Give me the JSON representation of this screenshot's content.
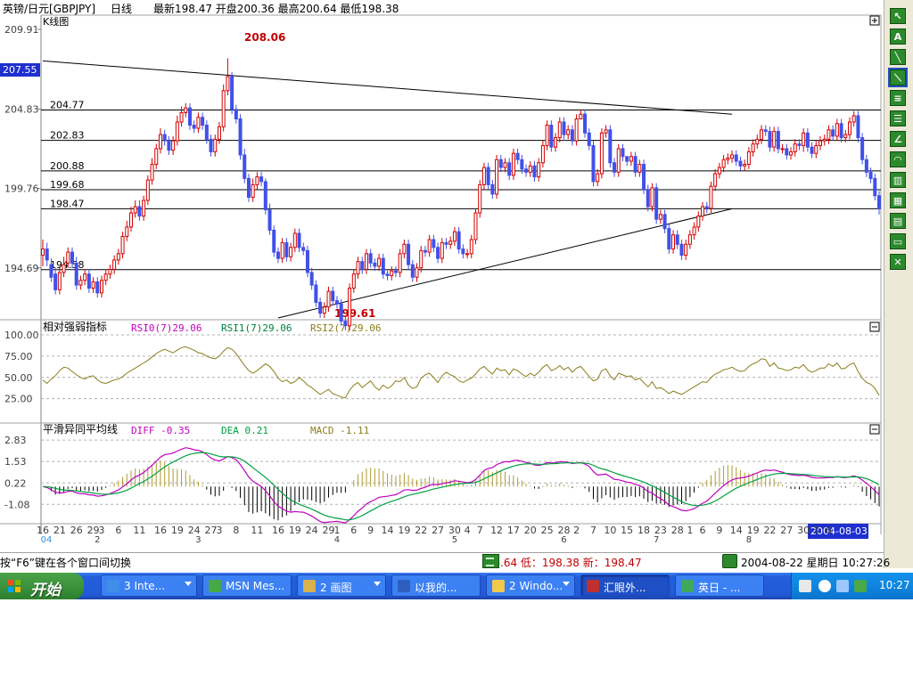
{
  "header": {
    "instrument": "英镑/日元[GBPJPY]",
    "period": "日线",
    "quote_line": "最新198.47 开盘200.36 最高200.64 最低198.38"
  },
  "chart_data": [
    {
      "type": "candlestick",
      "title": "K线图",
      "y_ticks": [
        209.91,
        204.83,
        199.76,
        194.69
      ],
      "ylim": [
        191.5,
        209.91
      ],
      "y_cursor": "207.55",
      "annotations": {
        "high": "208.06",
        "low": "199.61"
      },
      "price_levels": [
        "204.77",
        "202.83",
        "200.88",
        "199.68",
        "198.47",
        "194.58"
      ],
      "price_level_values": [
        204.77,
        202.83,
        200.88,
        199.68,
        198.47,
        194.58
      ],
      "trendline_upper": [
        {
          "i": 0,
          "v": 207.9
        },
        {
          "i": 164,
          "v": 204.5
        }
      ],
      "trendline_lower": [
        {
          "i": 56,
          "v": 191.5
        },
        {
          "i": 164,
          "v": 198.47
        }
      ],
      "x_day_labels": [
        "16",
        "21",
        "26",
        "29",
        "3",
        "6",
        "11",
        "16",
        "19",
        "24",
        "27",
        "3",
        "8",
        "11",
        "16",
        "19",
        "24",
        "29",
        "1",
        "6",
        "9",
        "14",
        "19",
        "22",
        "27",
        "30",
        "4",
        "7",
        "12",
        "17",
        "20",
        "25",
        "28",
        "2",
        "7",
        "10",
        "15",
        "18",
        "23",
        "28",
        "1",
        "6",
        "9",
        "14",
        "19",
        "22",
        "27",
        "30",
        "3",
        "6"
      ],
      "x_day_index": [
        0,
        4,
        8,
        12,
        14,
        18,
        23,
        28,
        32,
        36,
        40,
        42,
        46,
        51,
        56,
        60,
        64,
        68,
        70,
        74,
        78,
        82,
        86,
        90,
        94,
        98,
        101,
        104,
        108,
        112,
        116,
        120,
        124,
        127,
        131,
        135,
        139,
        143,
        147,
        151,
        154,
        157,
        161,
        165,
        169,
        173,
        177,
        181,
        184,
        187
      ],
      "x_month_labels": [
        "04",
        "2",
        "3",
        "4",
        "5",
        "6",
        "7",
        "8"
      ],
      "x_month_index": [
        0,
        13,
        37,
        70,
        98,
        124,
        146,
        168
      ],
      "cursor_date": "2004-08-03",
      "close": [
        195.9,
        195.2,
        194.1,
        193.3,
        194.4,
        194.9,
        195.7,
        195.0,
        193.6,
        193.9,
        194.3,
        193.4,
        193.8,
        193.1,
        193.9,
        194.3,
        194.6,
        195.2,
        195.6,
        196.7,
        197.3,
        198.2,
        198.6,
        198.0,
        199.0,
        200.3,
        201.3,
        202.3,
        203.2,
        202.8,
        202.2,
        202.8,
        204.0,
        204.6,
        204.9,
        203.8,
        203.6,
        204.3,
        203.8,
        202.9,
        202.1,
        202.9,
        203.7,
        206.0,
        206.9,
        204.8,
        204.2,
        201.9,
        200.4,
        199.2,
        200.0,
        200.5,
        200.2,
        198.4,
        197.1,
        195.7,
        195.3,
        196.3,
        195.4,
        196.0,
        196.9,
        196.0,
        195.8,
        194.4,
        193.6,
        192.5,
        191.8,
        192.2,
        193.2,
        192.6,
        192.4,
        191.3,
        191.0,
        193.4,
        194.3,
        195.1,
        194.6,
        195.6,
        195.0,
        194.8,
        195.3,
        194.3,
        194.2,
        194.5,
        194.4,
        195.6,
        196.2,
        194.9,
        194.1,
        194.7,
        195.8,
        195.7,
        196.5,
        196.0,
        195.3,
        196.3,
        196.2,
        196.4,
        197.0,
        195.9,
        195.6,
        195.6,
        196.5,
        198.2,
        200.0,
        201.1,
        200.0,
        199.4,
        201.6,
        201.1,
        201.4,
        200.6,
        202.0,
        201.6,
        201.0,
        200.8,
        201.2,
        200.5,
        201.4,
        202.5,
        203.8,
        202.4,
        203.0,
        204.0,
        203.2,
        203.5,
        202.8,
        204.2,
        204.5,
        203.3,
        202.5,
        200.2,
        200.7,
        203.3,
        203.5,
        201.4,
        200.8,
        202.3,
        201.8,
        201.5,
        201.8,
        200.8,
        201.3,
        199.7,
        198.6,
        199.8,
        197.8,
        198.1,
        197.2,
        195.9,
        196.8,
        196.2,
        195.5,
        196.2,
        196.8,
        197.3,
        198.0,
        198.6,
        198.5,
        199.9,
        200.7,
        201.1,
        201.6,
        201.7,
        201.9,
        201.5,
        201.2,
        201.3,
        202.1,
        202.6,
        202.9,
        203.5,
        203.4,
        202.4,
        203.4,
        202.3,
        202.3,
        201.9,
        202.1,
        202.6,
        202.5,
        203.3,
        202.4,
        202.0,
        202.5,
        202.8,
        202.9,
        203.5,
        203.1,
        203.9,
        203.0,
        203.2,
        204.0,
        204.4,
        203.0,
        201.6,
        200.8,
        200.4,
        199.3,
        198.47
      ],
      "open": [
        195.5,
        195.9,
        194.9,
        194.3,
        193.3,
        194.4,
        195.0,
        195.7,
        195.0,
        193.6,
        193.9,
        194.3,
        193.4,
        193.8,
        193.1,
        193.9,
        194.3,
        194.6,
        195.2,
        195.6,
        196.7,
        197.3,
        198.2,
        198.6,
        198.0,
        199.0,
        200.3,
        201.3,
        202.3,
        203.2,
        202.8,
        202.2,
        202.8,
        204.0,
        204.6,
        204.9,
        203.8,
        203.6,
        204.3,
        203.8,
        202.9,
        202.1,
        202.9,
        203.7,
        206.0,
        206.9,
        204.8,
        204.2,
        201.9,
        200.4,
        199.2,
        200.0,
        200.5,
        200.2,
        198.4,
        197.1,
        195.7,
        195.3,
        196.3,
        195.4,
        196.0,
        196.9,
        196.0,
        195.8,
        194.4,
        193.6,
        192.5,
        191.8,
        192.2,
        193.2,
        192.6,
        192.4,
        191.3,
        191.0,
        193.4,
        194.3,
        195.1,
        194.6,
        195.6,
        195.0,
        194.8,
        195.3,
        194.3,
        194.2,
        194.5,
        194.4,
        195.6,
        196.2,
        194.9,
        194.1,
        194.7,
        195.8,
        195.7,
        196.5,
        196.0,
        195.3,
        196.3,
        196.2,
        196.4,
        197.0,
        195.9,
        195.6,
        195.6,
        196.5,
        198.2,
        200.0,
        201.1,
        200.0,
        199.4,
        201.6,
        201.1,
        201.4,
        200.6,
        202.0,
        201.6,
        201.0,
        200.8,
        201.2,
        200.5,
        201.4,
        202.5,
        203.8,
        202.4,
        203.0,
        204.0,
        203.2,
        203.5,
        202.8,
        204.2,
        204.5,
        203.3,
        202.5,
        200.2,
        200.7,
        203.3,
        203.5,
        201.4,
        200.8,
        202.3,
        201.8,
        201.5,
        201.8,
        200.8,
        201.3,
        199.7,
        198.6,
        199.8,
        197.8,
        198.1,
        197.2,
        195.9,
        196.8,
        196.2,
        195.5,
        196.2,
        196.8,
        197.3,
        198.0,
        198.6,
        198.5,
        199.9,
        200.7,
        201.1,
        201.6,
        201.7,
        201.9,
        201.5,
        201.2,
        201.3,
        202.1,
        202.6,
        202.9,
        203.5,
        203.4,
        202.4,
        203.4,
        202.3,
        202.3,
        201.9,
        202.1,
        202.6,
        202.5,
        203.3,
        202.4,
        202.0,
        202.5,
        202.8,
        202.9,
        203.5,
        203.1,
        203.9,
        203.0,
        203.2,
        204.0,
        204.4,
        203.0,
        201.6,
        200.8,
        200.4,
        199.3
      ],
      "high": [
        196.5,
        196.3,
        195.3,
        194.7,
        194.8,
        195.4,
        196.0,
        196.0,
        195.4,
        194.2,
        194.6,
        194.6,
        194.1,
        194.1,
        194.2,
        194.6,
        194.9,
        195.5,
        195.9,
        197.0,
        197.7,
        198.6,
        199.0,
        199.0,
        199.3,
        200.6,
        201.7,
        202.6,
        203.6,
        203.5,
        203.1,
        203.1,
        204.4,
        205.0,
        205.2,
        205.2,
        204.1,
        204.6,
        204.6,
        204.1,
        203.2,
        203.2,
        204.0,
        206.4,
        208.06,
        207.2,
        205.1,
        204.5,
        202.3,
        200.7,
        200.4,
        200.8,
        200.8,
        200.4,
        198.8,
        197.4,
        196.0,
        196.6,
        196.6,
        196.3,
        197.2,
        197.2,
        196.3,
        196.1,
        194.7,
        193.9,
        192.8,
        192.5,
        193.5,
        193.5,
        192.9,
        192.7,
        191.6,
        193.7,
        194.6,
        195.4,
        195.4,
        195.9,
        195.9,
        195.3,
        195.6,
        195.6,
        194.6,
        194.8,
        194.8,
        195.9,
        196.5,
        196.5,
        195.2,
        195.0,
        196.1,
        196.1,
        196.8,
        196.8,
        196.3,
        196.6,
        196.6,
        196.7,
        197.3,
        197.3,
        196.2,
        195.9,
        196.8,
        198.5,
        200.3,
        201.4,
        201.4,
        200.3,
        201.9,
        201.9,
        201.7,
        201.7,
        202.3,
        202.3,
        201.9,
        201.3,
        201.5,
        201.5,
        201.7,
        202.8,
        204.1,
        204.1,
        203.3,
        204.3,
        204.3,
        203.8,
        203.8,
        204.5,
        204.8,
        204.8,
        203.6,
        202.8,
        201.0,
        203.6,
        203.8,
        203.8,
        201.7,
        202.6,
        202.6,
        201.8,
        202.1,
        202.1,
        201.6,
        201.6,
        200.0,
        200.1,
        200.1,
        198.4,
        198.4,
        197.5,
        197.1,
        197.1,
        196.5,
        196.5,
        197.1,
        197.6,
        198.3,
        198.9,
        198.9,
        200.2,
        201.0,
        201.4,
        201.9,
        202.0,
        202.2,
        202.2,
        201.8,
        201.6,
        202.4,
        202.9,
        203.2,
        203.8,
        203.8,
        203.7,
        203.7,
        203.7,
        202.6,
        202.6,
        202.4,
        202.9,
        202.9,
        203.6,
        203.6,
        202.7,
        202.8,
        203.1,
        203.2,
        203.8,
        203.8,
        204.2,
        204.2,
        203.5,
        204.3,
        204.7,
        204.7,
        203.3,
        201.9,
        201.1,
        200.7,
        199.6
      ],
      "low": [
        194.8,
        194.8,
        193.8,
        193.0,
        193.0,
        194.1,
        194.7,
        194.7,
        193.3,
        193.3,
        193.6,
        193.1,
        193.1,
        192.8,
        192.8,
        193.6,
        194.0,
        194.3,
        194.9,
        195.3,
        196.4,
        197.0,
        197.9,
        197.7,
        197.7,
        198.7,
        200.0,
        201.0,
        202.0,
        202.5,
        201.9,
        201.9,
        202.5,
        203.7,
        204.3,
        203.5,
        203.3,
        203.3,
        203.5,
        202.6,
        201.8,
        201.8,
        202.6,
        203.4,
        205.7,
        204.5,
        203.9,
        201.6,
        200.1,
        198.9,
        198.9,
        199.7,
        199.9,
        198.1,
        196.8,
        195.4,
        195.0,
        195.0,
        195.1,
        195.1,
        195.7,
        195.7,
        195.5,
        194.1,
        193.3,
        192.2,
        191.5,
        191.5,
        191.9,
        192.3,
        192.1,
        191.0,
        190.7,
        190.7,
        193.1,
        194.0,
        194.3,
        194.3,
        194.7,
        194.5,
        194.5,
        194.0,
        193.9,
        193.9,
        194.1,
        194.1,
        195.3,
        194.6,
        193.8,
        193.8,
        194.4,
        195.4,
        195.4,
        195.7,
        195.0,
        195.0,
        195.9,
        195.9,
        196.1,
        195.6,
        195.3,
        195.3,
        195.3,
        196.2,
        197.9,
        199.7,
        199.7,
        199.1,
        199.1,
        200.8,
        200.8,
        200.3,
        200.3,
        201.3,
        200.7,
        200.5,
        200.5,
        200.2,
        200.2,
        201.1,
        202.2,
        202.1,
        202.1,
        202.7,
        202.9,
        202.9,
        202.5,
        202.5,
        204.2,
        203.0,
        202.2,
        199.9,
        199.9,
        200.4,
        203.0,
        201.1,
        200.5,
        200.5,
        201.5,
        201.2,
        201.2,
        200.5,
        200.5,
        199.4,
        198.3,
        198.3,
        197.5,
        197.5,
        196.9,
        195.6,
        195.6,
        195.9,
        195.2,
        195.2,
        195.9,
        196.5,
        197.0,
        197.7,
        198.2,
        198.2,
        199.6,
        200.4,
        200.8,
        201.3,
        201.4,
        201.2,
        200.9,
        200.9,
        201.0,
        201.8,
        202.3,
        202.6,
        203.1,
        202.1,
        202.1,
        202.0,
        202.0,
        201.6,
        201.6,
        201.8,
        202.2,
        202.1,
        202.1,
        201.7,
        201.7,
        202.2,
        202.5,
        202.6,
        202.8,
        202.8,
        202.7,
        202.7,
        202.9,
        203.7,
        202.7,
        201.3,
        200.5,
        200.1,
        199.0,
        198.1
      ]
    },
    {
      "type": "line",
      "title": "相对强弱指标",
      "series": [
        {
          "name": "RSI0(7)29.06",
          "color": "#c000c0"
        },
        {
          "name": "RSI1(7)29.06",
          "color": "#008040"
        },
        {
          "name": "RSI2(7)29.06",
          "color": "#8b7d1a"
        }
      ],
      "y_ticks": [
        "100.00",
        "75.00",
        "50.00",
        "25.00"
      ],
      "y_tick_values": [
        100,
        75,
        50,
        25
      ],
      "ylim": [
        10,
        100
      ],
      "values": [
        47,
        43,
        48,
        52,
        58,
        62,
        61,
        57,
        53,
        50,
        48,
        51,
        52,
        47,
        44,
        43,
        45,
        47,
        48,
        51,
        55,
        58,
        61,
        64,
        67,
        70,
        74,
        78,
        81,
        83,
        81,
        79,
        82,
        85,
        86,
        84,
        82,
        79,
        78,
        75,
        73,
        72,
        75,
        81,
        85,
        83,
        78,
        71,
        64,
        58,
        55,
        58,
        62,
        66,
        63,
        57,
        49,
        45,
        47,
        43,
        45,
        50,
        46,
        41,
        38,
        34,
        30,
        33,
        36,
        31,
        29,
        27,
        26,
        35,
        41,
        44,
        38,
        42,
        46,
        39,
        35,
        41,
        37,
        40,
        46,
        45,
        50,
        41,
        37,
        39,
        49,
        53,
        55,
        50,
        44,
        52,
        56,
        53,
        51,
        46,
        44,
        47,
        49,
        54,
        60,
        63,
        58,
        54,
        61,
        58,
        59,
        53,
        60,
        58,
        54,
        51,
        55,
        52,
        56,
        62,
        65,
        58,
        60,
        64,
        59,
        62,
        56,
        61,
        63,
        57,
        51,
        46,
        48,
        58,
        60,
        52,
        47,
        55,
        53,
        51,
        52,
        47,
        49,
        44,
        39,
        45,
        37,
        38,
        35,
        31,
        34,
        32,
        30,
        33,
        36,
        39,
        42,
        45,
        44,
        50,
        54,
        56,
        59,
        60,
        62,
        59,
        57,
        58,
        63,
        66,
        68,
        72,
        71,
        63,
        67,
        61,
        60,
        58,
        59,
        62,
        61,
        65,
        59,
        56,
        58,
        61,
        61,
        66,
        63,
        67,
        60,
        61,
        65,
        67,
        57,
        49,
        44,
        42,
        37,
        29.06
      ]
    },
    {
      "type": "macd",
      "title": "平滑异同平均线",
      "series": [
        {
          "name": "DIFF -0.35",
          "color": "#c000c0"
        },
        {
          "name": "DEA 0.21",
          "color": "#00a040"
        },
        {
          "name": "MACD -1.11",
          "color": "#8b7d1a"
        }
      ],
      "y_ticks": [
        "2.83",
        "1.53",
        "0.22",
        "-1.08"
      ],
      "y_tick_values": [
        2.83,
        1.53,
        0.22,
        -1.08
      ],
      "ylim": [
        -2.15,
        3.0
      ]
    }
  ],
  "toolbar": {
    "buttons": [
      "pointer",
      "A",
      "trendline",
      "channel",
      "parallel",
      "fibonacci",
      "angle",
      "arc",
      "gann",
      "cycle",
      "fan",
      "rectangle",
      "delete"
    ]
  },
  "status": {
    "hint": "按“F6”键在各个窗口间切换",
    "price": ".64 低：198.38 新：198.47",
    "datetime": "2004-08-22 星期日 10:27:26"
  },
  "taskbar": {
    "start": "开始",
    "tasks": [
      {
        "label": "3 Inte...",
        "icon_color": "#3f8fe8",
        "dropdown": true
      },
      {
        "label": "MSN Mes...",
        "icon_color": "#46a846",
        "dropdown": false
      },
      {
        "label": "2 画图",
        "icon_color": "#d8b24a",
        "dropdown": true
      },
      {
        "label": "以我的...",
        "icon_color": "#2e5fbf",
        "dropdown": false
      },
      {
        "label": "2 Windo...",
        "icon_color": "#f2c94c",
        "dropdown": true
      },
      {
        "label": "汇眼外...",
        "icon_color": "#c03030",
        "dropdown": false
      },
      {
        "label": "英日 - ...",
        "icon_color": "#3fa85a",
        "dropdown": false
      }
    ],
    "clock": "10:27"
  }
}
